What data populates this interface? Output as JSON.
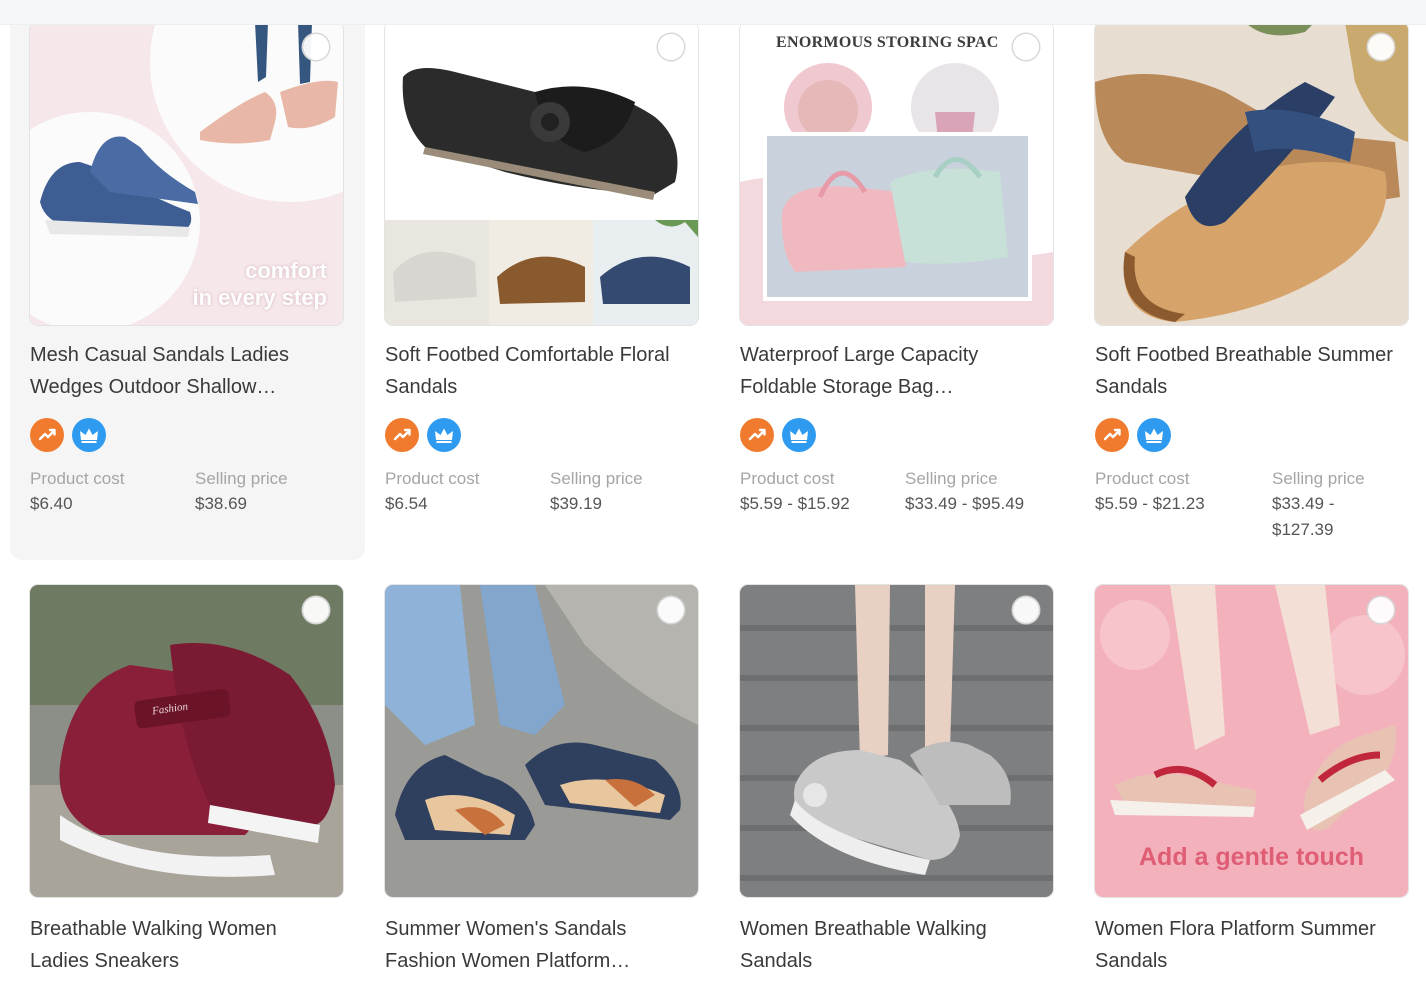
{
  "labels": {
    "product_cost": "Product cost",
    "selling_price": "Selling price"
  },
  "colors": {
    "trend_badge": "#f07b2e",
    "vip_badge": "#2f9bf0"
  },
  "products": [
    {
      "title": "Mesh Casual Sandals Ladies Wedges Outdoor Shallow…",
      "image_text": [
        "comfort",
        "in every step"
      ],
      "product_cost": "$6.40",
      "selling_price": "$38.69"
    },
    {
      "title": "Soft Footbed Comfortable Floral Sandals",
      "product_cost": "$6.54",
      "selling_price": "$39.19"
    },
    {
      "title": "Waterproof Large Capacity Foldable Storage Bag…",
      "image_text": [
        "ENORMOUS STORING SPAC"
      ],
      "product_cost": "$5.59 - $15.92",
      "selling_price": "$33.49 - $95.49"
    },
    {
      "title": "Soft Footbed Breathable Summer Sandals",
      "product_cost": "$5.59 - $21.23",
      "selling_price": "$33.49 - $127.39"
    },
    {
      "title": "Breathable Walking Women Ladies Sneakers",
      "image_text": [
        "Fashion"
      ]
    },
    {
      "title": "Summer Women's Sandals Fashion Women Platform…"
    },
    {
      "title": "Women Breathable Walking Sandals"
    },
    {
      "title": "Women Flora Platform Summer Sandals",
      "image_text": [
        "Add a gentle touch"
      ]
    }
  ]
}
